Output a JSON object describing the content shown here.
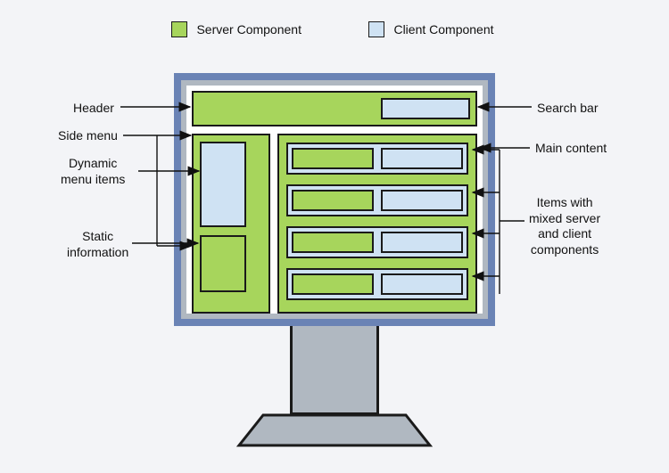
{
  "legend": {
    "server": "Server Component",
    "client": "Client Component"
  },
  "labels": {
    "header": "Header",
    "side_menu": "Side menu",
    "dynamic_menu": "Dynamic\nmenu items",
    "static_info": "Static\ninformation",
    "search_bar": "Search bar",
    "main_content": "Main content",
    "mixed_items": "Items with\nmixed server\nand client\ncomponents"
  }
}
